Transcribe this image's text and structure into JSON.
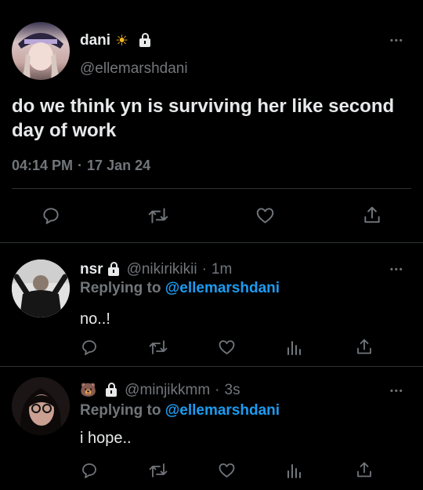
{
  "main_tweet": {
    "display_name": "dani",
    "name_emoji": "☀",
    "handle": "@ellemarshdani",
    "text": "do we think yn is surviving her like second day of work",
    "time": "04:14 PM",
    "separator": "·",
    "date": "17 Jan 24",
    "more": "•••"
  },
  "replies": [
    {
      "display_name": "nsr",
      "handle": "@nikirikikii",
      "time": "1m",
      "separator": "·",
      "replying_label": "Replying to",
      "replying_handle": "@ellemarshdani",
      "text": "no..!",
      "more": "•••"
    },
    {
      "display_name": "🐻",
      "handle": "@minjikkmm",
      "time": "3s",
      "separator": "·",
      "replying_label": "Replying to",
      "replying_handle": "@ellemarshdani",
      "text": "i hope..",
      "more": "•••"
    }
  ],
  "icons": {
    "reply": "reply-icon",
    "retweet": "retweet-icon",
    "like": "heart-icon",
    "views": "views-icon",
    "share": "share-icon",
    "lock": "lock-icon",
    "sun": "sun-icon",
    "more": "more-icon"
  },
  "colors": {
    "background": "#000000",
    "text": "#e7e9ea",
    "muted": "#71767b",
    "link": "#1d9bf0",
    "divider": "#2f3336"
  }
}
